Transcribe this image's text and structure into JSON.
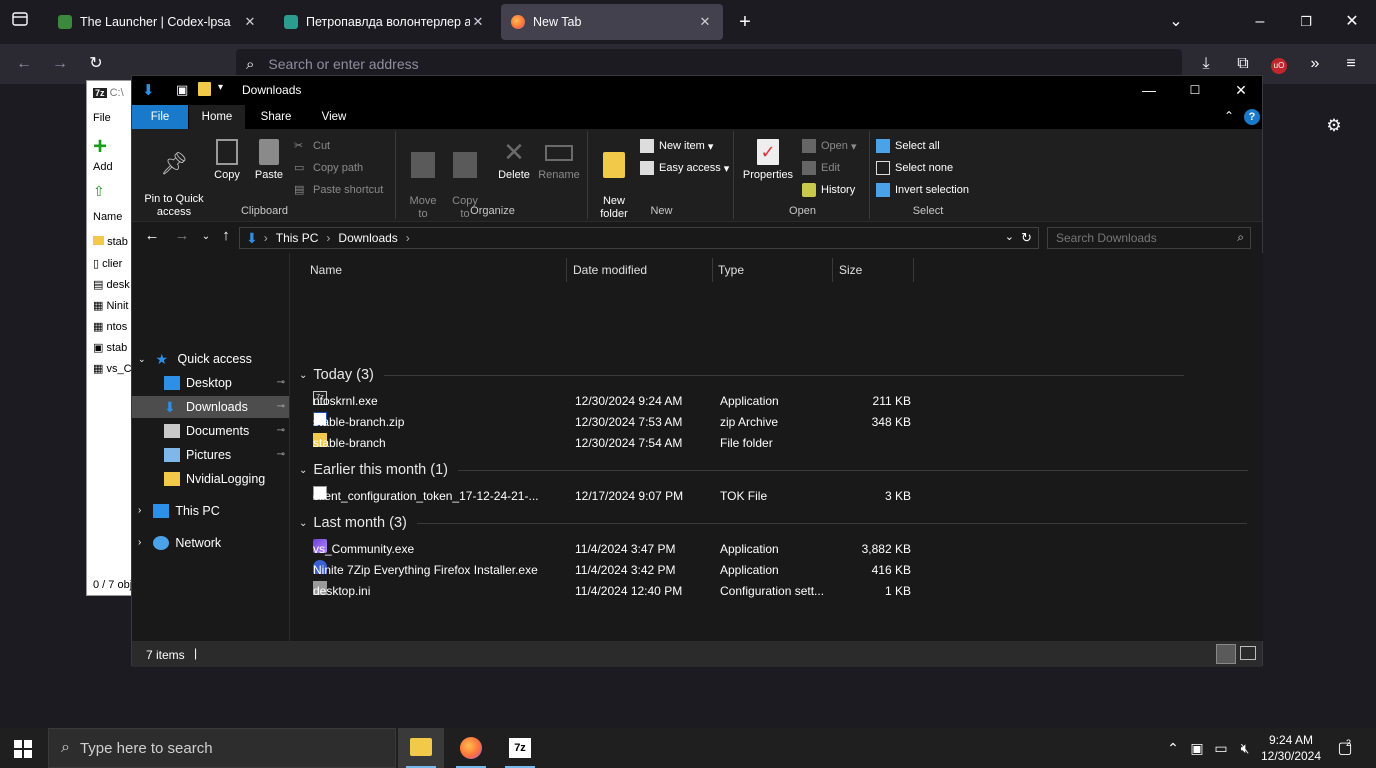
{
  "firefox": {
    "tabs": [
      {
        "title": "The Launcher | Codex-lpsa",
        "favicon_color": "#3b8a3b"
      },
      {
        "title": "Петропавлда волонтерлер ан",
        "favicon_color": "#2a9d8f"
      },
      {
        "title": "New Tab",
        "favicon_color": "#ff7139"
      }
    ],
    "url_placeholder": "Search or enter address"
  },
  "sevenzip": {
    "title": "C:\\",
    "menu_file": "File",
    "add_label": "Add",
    "name_header": "Name",
    "rows": [
      "stab",
      "clier",
      "desk",
      "Ninit",
      "ntos",
      "stab",
      "vs_C"
    ],
    "status": "0 / 7 obj"
  },
  "explorer": {
    "title": "Downloads",
    "menu": {
      "file": "File",
      "home": "Home",
      "share": "Share",
      "view": "View"
    },
    "ribbon": {
      "clipboard": {
        "label": "Clipboard",
        "pin": "Pin to Quick\naccess",
        "copy": "Copy",
        "paste": "Paste",
        "cut": "Cut",
        "copy_path": "Copy path",
        "paste_shortcut": "Paste shortcut"
      },
      "organize": {
        "label": "Organize",
        "move_to": "Move\nto",
        "copy_to": "Copy\nto",
        "delete": "Delete",
        "rename": "Rename"
      },
      "new": {
        "label": "New",
        "new_folder": "New\nfolder",
        "new_item": "New item",
        "easy_access": "Easy access"
      },
      "open": {
        "label": "Open",
        "properties": "Properties",
        "open": "Open",
        "edit": "Edit",
        "history": "History"
      },
      "select": {
        "label": "Select",
        "select_all": "Select all",
        "select_none": "Select none",
        "invert": "Invert selection"
      }
    },
    "breadcrumb": [
      "This PC",
      "Downloads"
    ],
    "search_placeholder": "Search Downloads",
    "nav": {
      "quick_access": "Quick access",
      "items": [
        "Desktop",
        "Downloads",
        "Documents",
        "Pictures",
        "NvidiaLogging"
      ],
      "this_pc": "This PC",
      "network": "Network"
    },
    "columns": {
      "name": "Name",
      "date": "Date modified",
      "type": "Type",
      "size": "Size"
    },
    "groups": [
      {
        "title": "Today (3)",
        "files": [
          {
            "name": "ntoskrnl.exe",
            "date": "12/30/2024 9:24 AM",
            "type": "Application",
            "size": "211 KB",
            "icon": "7z-exe-icon"
          },
          {
            "name": "stable-branch.zip",
            "date": "12/30/2024 7:53 AM",
            "type": "zip Archive",
            "size": "348 KB",
            "icon": "zip-icon"
          },
          {
            "name": "stable-branch",
            "date": "12/30/2024 7:54 AM",
            "type": "File folder",
            "size": "",
            "icon": "folder-icon"
          }
        ]
      },
      {
        "title": "Earlier this month (1)",
        "files": [
          {
            "name": "client_configuration_token_17-12-24-21-...",
            "date": "12/17/2024 9:07 PM",
            "type": "TOK File",
            "size": "3 KB",
            "icon": "file-icon"
          }
        ]
      },
      {
        "title": "Last month (3)",
        "files": [
          {
            "name": "vs_Community.exe",
            "date": "11/4/2024 3:47 PM",
            "type": "Application",
            "size": "3,882 KB",
            "icon": "visual-studio-icon"
          },
          {
            "name": "Ninite 7Zip Everything Firefox Installer.exe",
            "date": "11/4/2024 3:42 PM",
            "type": "Application",
            "size": "416 KB",
            "icon": "ninite-icon"
          },
          {
            "name": "desktop.ini",
            "date": "11/4/2024 12:40 PM",
            "type": "Configuration sett...",
            "size": "1 KB",
            "icon": "settings-file-icon"
          }
        ]
      }
    ],
    "status": "7 items"
  },
  "taskbar": {
    "search_placeholder": "Type here to search",
    "time": "9:24 AM",
    "date": "12/30/2024",
    "notification_count": "2"
  }
}
